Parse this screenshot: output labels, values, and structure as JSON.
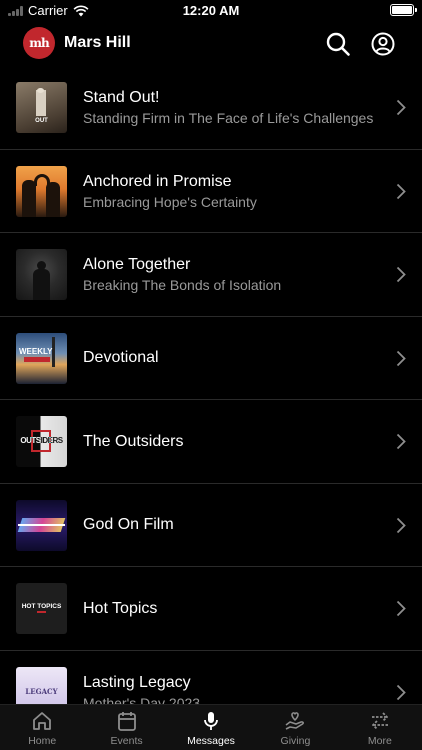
{
  "status_bar": {
    "carrier": "Carrier",
    "time": "12:20 AM"
  },
  "header": {
    "logo_text": "mh",
    "title": "Mars Hill"
  },
  "messages": [
    {
      "title": "Stand Out!",
      "subtitle": "Standing Firm in The Face of Life's Challenges",
      "thumb_text": "OUT"
    },
    {
      "title": "Anchored in Promise",
      "subtitle": "Embracing Hope's Certainty",
      "thumb_text": ""
    },
    {
      "title": "Alone Together",
      "subtitle": "Breaking The Bonds of Isolation",
      "thumb_text": ""
    },
    {
      "title": "Devotional",
      "subtitle": "",
      "thumb_text": "WEEKLY"
    },
    {
      "title": "The Outsiders",
      "subtitle": "",
      "thumb_text": "OUTSIDERS"
    },
    {
      "title": "God On Film",
      "subtitle": "",
      "thumb_text": ""
    },
    {
      "title": "Hot Topics",
      "subtitle": "",
      "thumb_text": "HOT TOPICS"
    },
    {
      "title": "Lasting Legacy",
      "subtitle": "Mother's Day 2023",
      "thumb_text": "LEGACY"
    }
  ],
  "tabs": [
    {
      "label": "Home",
      "icon": "home-icon"
    },
    {
      "label": "Events",
      "icon": "calendar-icon"
    },
    {
      "label": "Messages",
      "icon": "microphone-icon"
    },
    {
      "label": "Giving",
      "icon": "giving-hand-icon"
    },
    {
      "label": "More",
      "icon": "swap-arrows-icon"
    }
  ],
  "colors": {
    "accent": "#c1272d",
    "background": "#000000",
    "inactive_tab": "#8e8e8e",
    "subtitle": "#9a9a9a"
  }
}
